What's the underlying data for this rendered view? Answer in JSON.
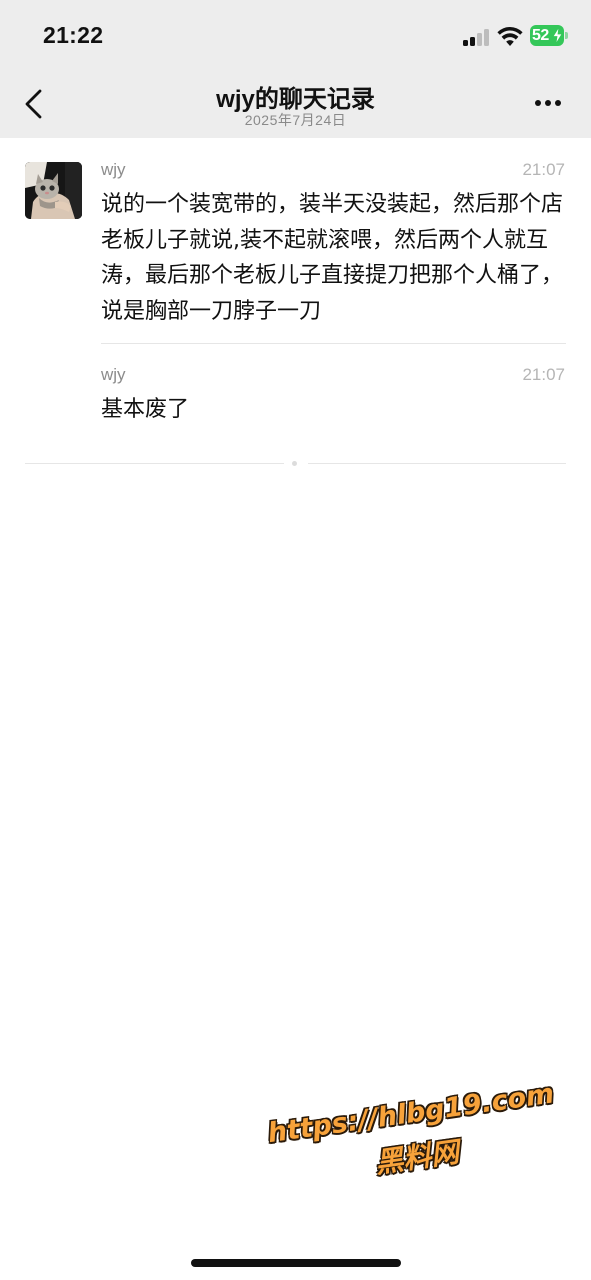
{
  "status_bar": {
    "time": "21:22",
    "battery_level": "52",
    "battery_color": "#34c759",
    "icons": [
      "cellular-signal-icon",
      "wifi-icon",
      "battery-charging-icon"
    ]
  },
  "nav": {
    "back_icon": "chevron-left-icon",
    "title": "wjy的聊天记录",
    "subtitle": "2025年7月24日",
    "more_icon": "more-dots-icon",
    "background_color": "#ededed"
  },
  "messages": [
    {
      "sender": "wjy",
      "time": "21:07",
      "text": "说的一个装宽带的，装半天没装起，然后那个店老板儿子就说,装不起就滚喂，然后两个人就互涛，最后那个老板儿子直接提刀把那个人桶了，说是胸部一刀脖子一刀",
      "avatar": "kitten-photo"
    },
    {
      "sender": "wjy",
      "time": "21:07",
      "text": "基本废了"
    }
  ],
  "watermark": {
    "url": "https://hlbg19.com",
    "name": "黑料网",
    "color": "#f7a23a"
  }
}
